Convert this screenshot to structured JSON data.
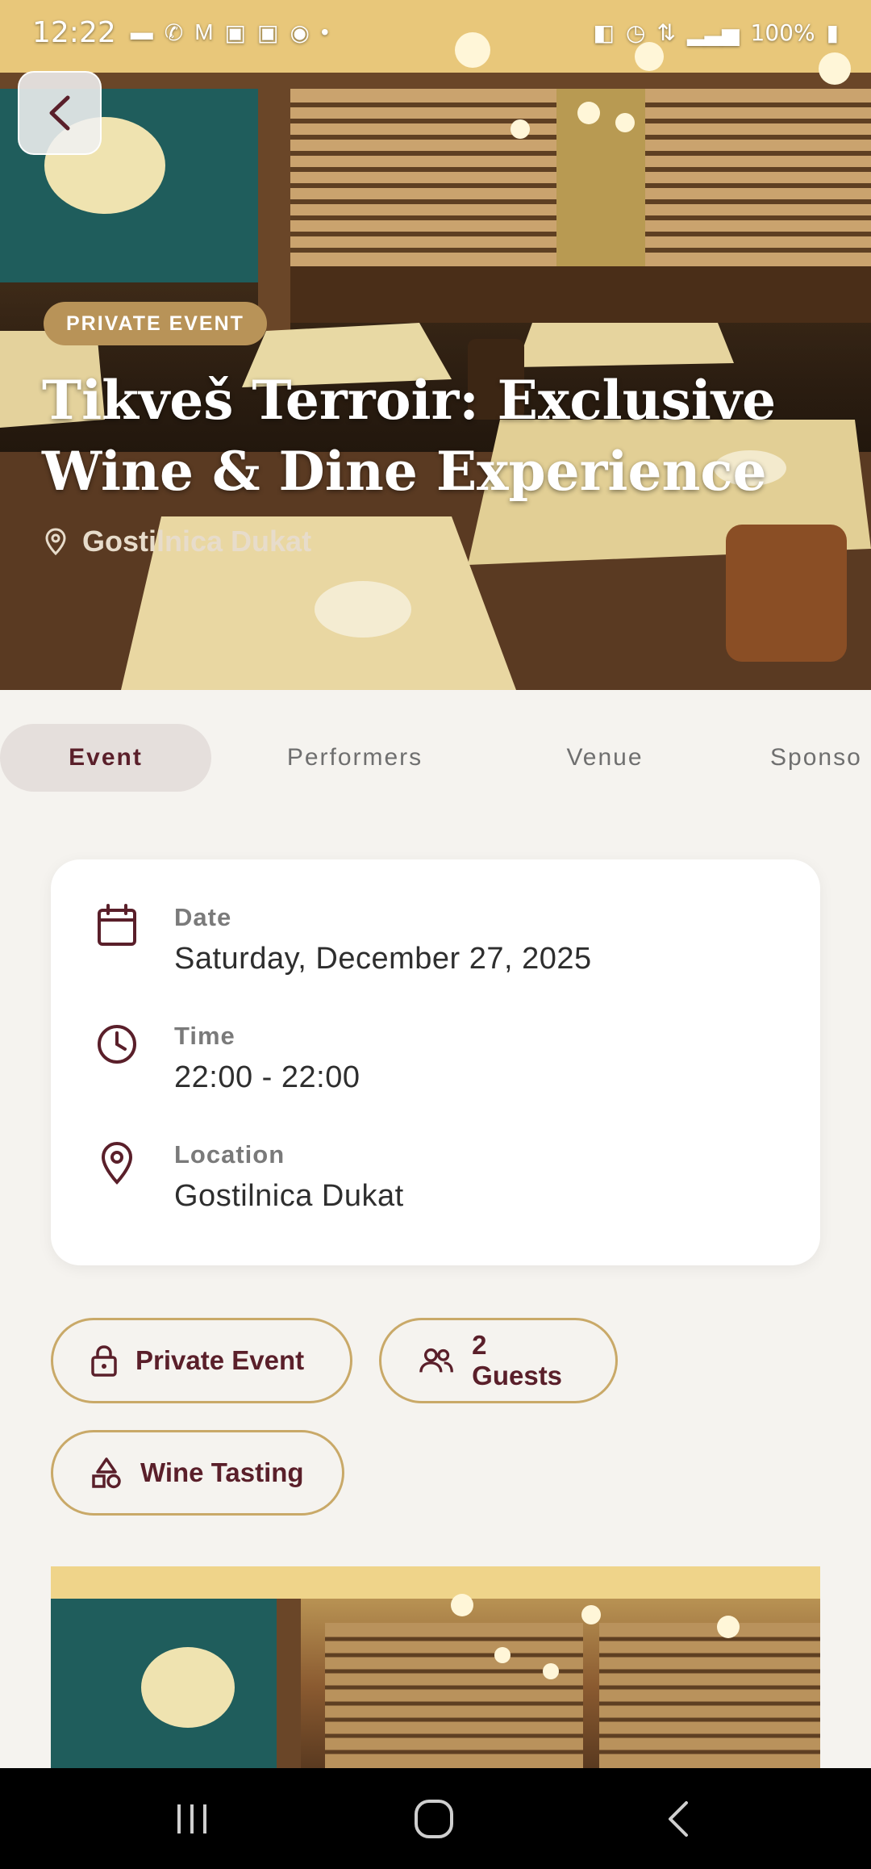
{
  "status_bar": {
    "time": "12:22",
    "battery": "100%",
    "left_icons": [
      "message-icon",
      "phone-icon",
      "gmail-icon",
      "calendar-icon",
      "calendar-icon",
      "lock-icon",
      "dot-icon"
    ],
    "right_icons": [
      "sync-icon",
      "alarm-icon",
      "network-4g-icon",
      "signal-icon",
      "battery-icon"
    ]
  },
  "hero": {
    "badge": "PRIVATE EVENT",
    "title": "Tikveš Terroir: Exclusive Wine & Dine Experience",
    "location": "Gostilnica Dukat"
  },
  "tabs": [
    {
      "label": "Event",
      "active": true
    },
    {
      "label": "Performers",
      "active": false
    },
    {
      "label": "Venue",
      "active": false
    },
    {
      "label": "Sponso",
      "active": false
    }
  ],
  "details": {
    "date_label": "Date",
    "date_value": "Saturday, December 27, 2025",
    "time_label": "Time",
    "time_value": "22:00 - 22:00",
    "location_label": "Location",
    "location_value": "Gostilnica Dukat"
  },
  "chips": {
    "private": "Private Event",
    "guests": "2 Guests",
    "category": "Wine Tasting"
  },
  "colors": {
    "accent_burgundy": "#5a1f2a",
    "gold": "#c9a968",
    "badge_gold": "#b89358",
    "background": "#f5f3ef"
  }
}
